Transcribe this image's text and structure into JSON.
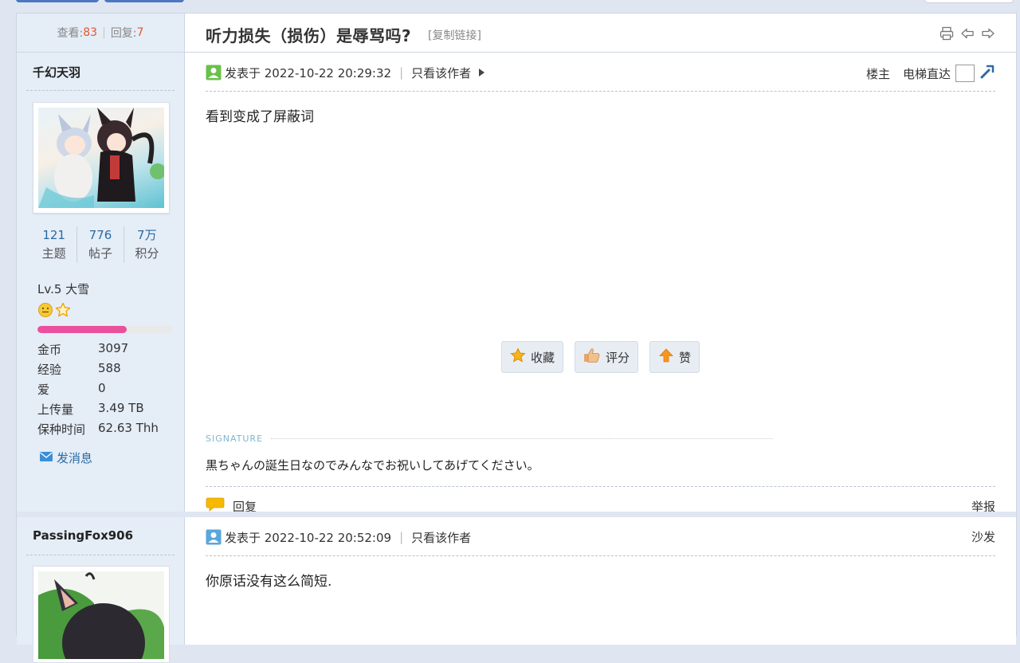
{
  "header": {
    "views_label": "查看:",
    "views": "83",
    "replies_label": "回复:",
    "replies": "7",
    "title": "听力损失（损伤）是辱骂吗?",
    "copy_link": "[复制链接]"
  },
  "post1": {
    "author": "千幻天羽",
    "stats": [
      {
        "value": "121",
        "label": "主题"
      },
      {
        "value": "776",
        "label": "帖子"
      },
      {
        "value": "7万",
        "label": "积分"
      }
    ],
    "level": "Lv.5 大雪",
    "level_progress": 0.66,
    "info": [
      {
        "label": "金币",
        "value": "3097"
      },
      {
        "label": "经验",
        "value": "588"
      },
      {
        "label": "爱",
        "value": "0"
      },
      {
        "label": "上传量",
        "value": "3.49 TB"
      },
      {
        "label": "保种时间",
        "value": "62.63 Thh"
      }
    ],
    "send_message": "发消息",
    "posted": "发表于 2022-10-22 20:29:32",
    "only_author": "只看该作者",
    "floor": "楼主",
    "jump": "电梯直达",
    "content": "看到变成了屏蔽词",
    "actions": [
      "收藏",
      "评分",
      "赞"
    ],
    "signature_label": "SIGNATURE",
    "signature": "黒ちゃんの誕生日なのでみんなでお祝いしてあげてください。",
    "reply": "回复",
    "report": "举报"
  },
  "post2": {
    "author": "PassingFox906",
    "posted": "发表于 2022-10-22 20:52:09",
    "only_author": "只看该作者",
    "floor": "沙发",
    "content": "你原话没有这么简短."
  },
  "colors": {
    "accent_blue": "#2b6aa3",
    "count_orange": "#e4572e",
    "level_bar": "#e9519a"
  }
}
